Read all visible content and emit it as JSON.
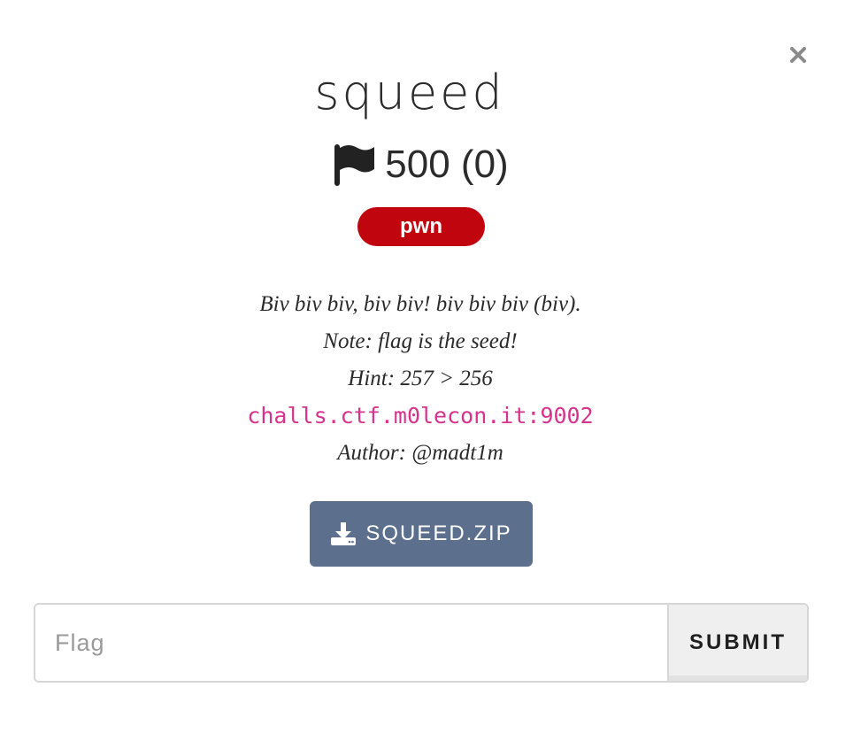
{
  "modal": {
    "close_label": "×",
    "title": "squeed",
    "points": "500 (0)",
    "category_tag": "pwn",
    "colors": {
      "tag": "#c0050f",
      "download_button": "#5c708e",
      "code": "#d6338c"
    }
  },
  "description": {
    "line1": "Biv biv biv, biv biv! biv biv biv (biv).",
    "line2": "Note: flag is the seed!",
    "line3": "Hint: 257 > 256",
    "connection": "challs.ctf.m0lecon.it:9002",
    "author": "Author: @madt1m"
  },
  "download": {
    "label": "SQUEED.ZIP",
    "icon": "download-icon"
  },
  "form": {
    "placeholder": "Flag",
    "value": "",
    "submit_label": "SUBMIT"
  }
}
